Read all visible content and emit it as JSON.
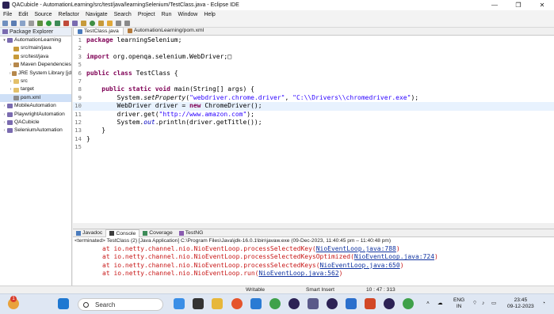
{
  "window": {
    "title": "QACubicle - AutomationLearning/src/test/java/learningSelenium/TestClass.java - Eclipse IDE",
    "minimize": "—",
    "maximize": "❐",
    "close": "✕"
  },
  "menu": [
    "File",
    "Edit",
    "Source",
    "Refactor",
    "Navigate",
    "Search",
    "Project",
    "Run",
    "Window",
    "Help"
  ],
  "explorer": {
    "tab_label": "Package Explorer",
    "items": [
      {
        "label": "AutomationLearning",
        "indent": 0,
        "twisty": "▾",
        "color": "#7a6bb0"
      },
      {
        "label": "src/main/java",
        "indent": 1,
        "twisty": "",
        "color": "#c79a3a"
      },
      {
        "label": "src/test/java",
        "indent": 1,
        "twisty": "",
        "color": "#c79a3a"
      },
      {
        "label": "Maven Dependencies",
        "indent": 1,
        "twisty": "›",
        "color": "#b6884c"
      },
      {
        "label": "JRE System Library [jd",
        "indent": 1,
        "twisty": "›",
        "color": "#b6884c"
      },
      {
        "label": "src",
        "indent": 1,
        "twisty": "›",
        "color": "#e3c06a"
      },
      {
        "label": "target",
        "indent": 1,
        "twisty": "›",
        "color": "#e3c06a"
      },
      {
        "label": "pom.xml",
        "indent": 1,
        "twisty": "",
        "color": "#8c8c8c",
        "selected": true
      },
      {
        "label": "MobileAutomation",
        "indent": 0,
        "twisty": "›",
        "color": "#7a6bb0"
      },
      {
        "label": "PlaywrightAutomation",
        "indent": 0,
        "twisty": "›",
        "color": "#7a6bb0"
      },
      {
        "label": "QACubicle",
        "indent": 0,
        "twisty": "›",
        "color": "#7a6bb0"
      },
      {
        "label": "SeleniumAutomation",
        "indent": 0,
        "twisty": "›",
        "color": "#7a6bb0"
      }
    ]
  },
  "editor_tabs": [
    {
      "label": "TestClass.java",
      "active": true
    },
    {
      "label": "AutomationLearning/pom.xml",
      "active": false
    }
  ],
  "code_lines": [
    {
      "n": "1",
      "html": "<span class=\"kw\">package</span> learningSelenium;"
    },
    {
      "n": "2",
      "html": ""
    },
    {
      "n": "3",
      "html": "<span class=\"kw\">import</span> org.openqa.selenium.WebDriver;&#9633;"
    },
    {
      "n": "5",
      "html": ""
    },
    {
      "n": "6",
      "html": "<span class=\"kw\">public</span> <span class=\"kw\">class</span> TestClass {"
    },
    {
      "n": "7",
      "html": ""
    },
    {
      "n": "8",
      "html": "    <span class=\"kw\">public</span> <span class=\"kw\">static</span> <span class=\"kw\">void</span> main(String[] args) {"
    },
    {
      "n": "9",
      "html": "        System.<span class=\"it\">setProperty</span>(<span class=\"str\">\"webdriver.chrome.driver\"</span>, <span class=\"str\">\"C:\\\\Drivers\\\\chromedriver.exe\"</span>);"
    },
    {
      "n": "10",
      "html": "        WebDriver driver = <span class=\"kw\">new</span> ChromeDriver();",
      "current": true
    },
    {
      "n": "11",
      "html": "        driver.get(<span class=\"str\">\"http://www.amazon.com\"</span>);"
    },
    {
      "n": "12",
      "html": "        System.<span class=\"fld it\">out</span>.println(driver.getTitle());"
    },
    {
      "n": "13",
      "html": "    }"
    },
    {
      "n": "14",
      "html": "}"
    },
    {
      "n": "15",
      "html": ""
    }
  ],
  "bottom_tabs": [
    "Javadoc",
    "Console",
    "Coverage",
    "TestNG"
  ],
  "console": {
    "terminated": "<terminated> TestClass (2) [Java Application] C:\\Program Files\\Java\\jdk-16.0.1\\bin\\javaw.exe  (09-Dec-2023, 11:40:45 pm – 11:40:48 pm)",
    "lines": [
      {
        "prefix": "at io.netty.channel.nio.NioEventLoop.processSelectedKey(",
        "link": "NioEventLoop.java:788",
        "suffix": ")"
      },
      {
        "prefix": "at io.netty.channel.nio.NioEventLoop.processSelectedKeysOptimized(",
        "link": "NioEventLoop.java:724",
        "suffix": ")"
      },
      {
        "prefix": "at io.netty.channel.nio.NioEventLoop.processSelectedKeys(",
        "link": "NioEventLoop.java:650",
        "suffix": ")"
      },
      {
        "prefix": "at io.netty.channel.nio.NioEventLoop.run(",
        "link": "NioEventLoop.java:562",
        "suffix": ")"
      }
    ]
  },
  "status": {
    "writable": "Writable",
    "insert_mode": "Smart Insert",
    "position": "10 : 47 : 313"
  },
  "taskbar": {
    "search_placeholder": "Search",
    "badge": "1",
    "lang_top": "ENG",
    "lang_bottom": "IN",
    "time": "23:45",
    "date": "09-12-2023"
  }
}
